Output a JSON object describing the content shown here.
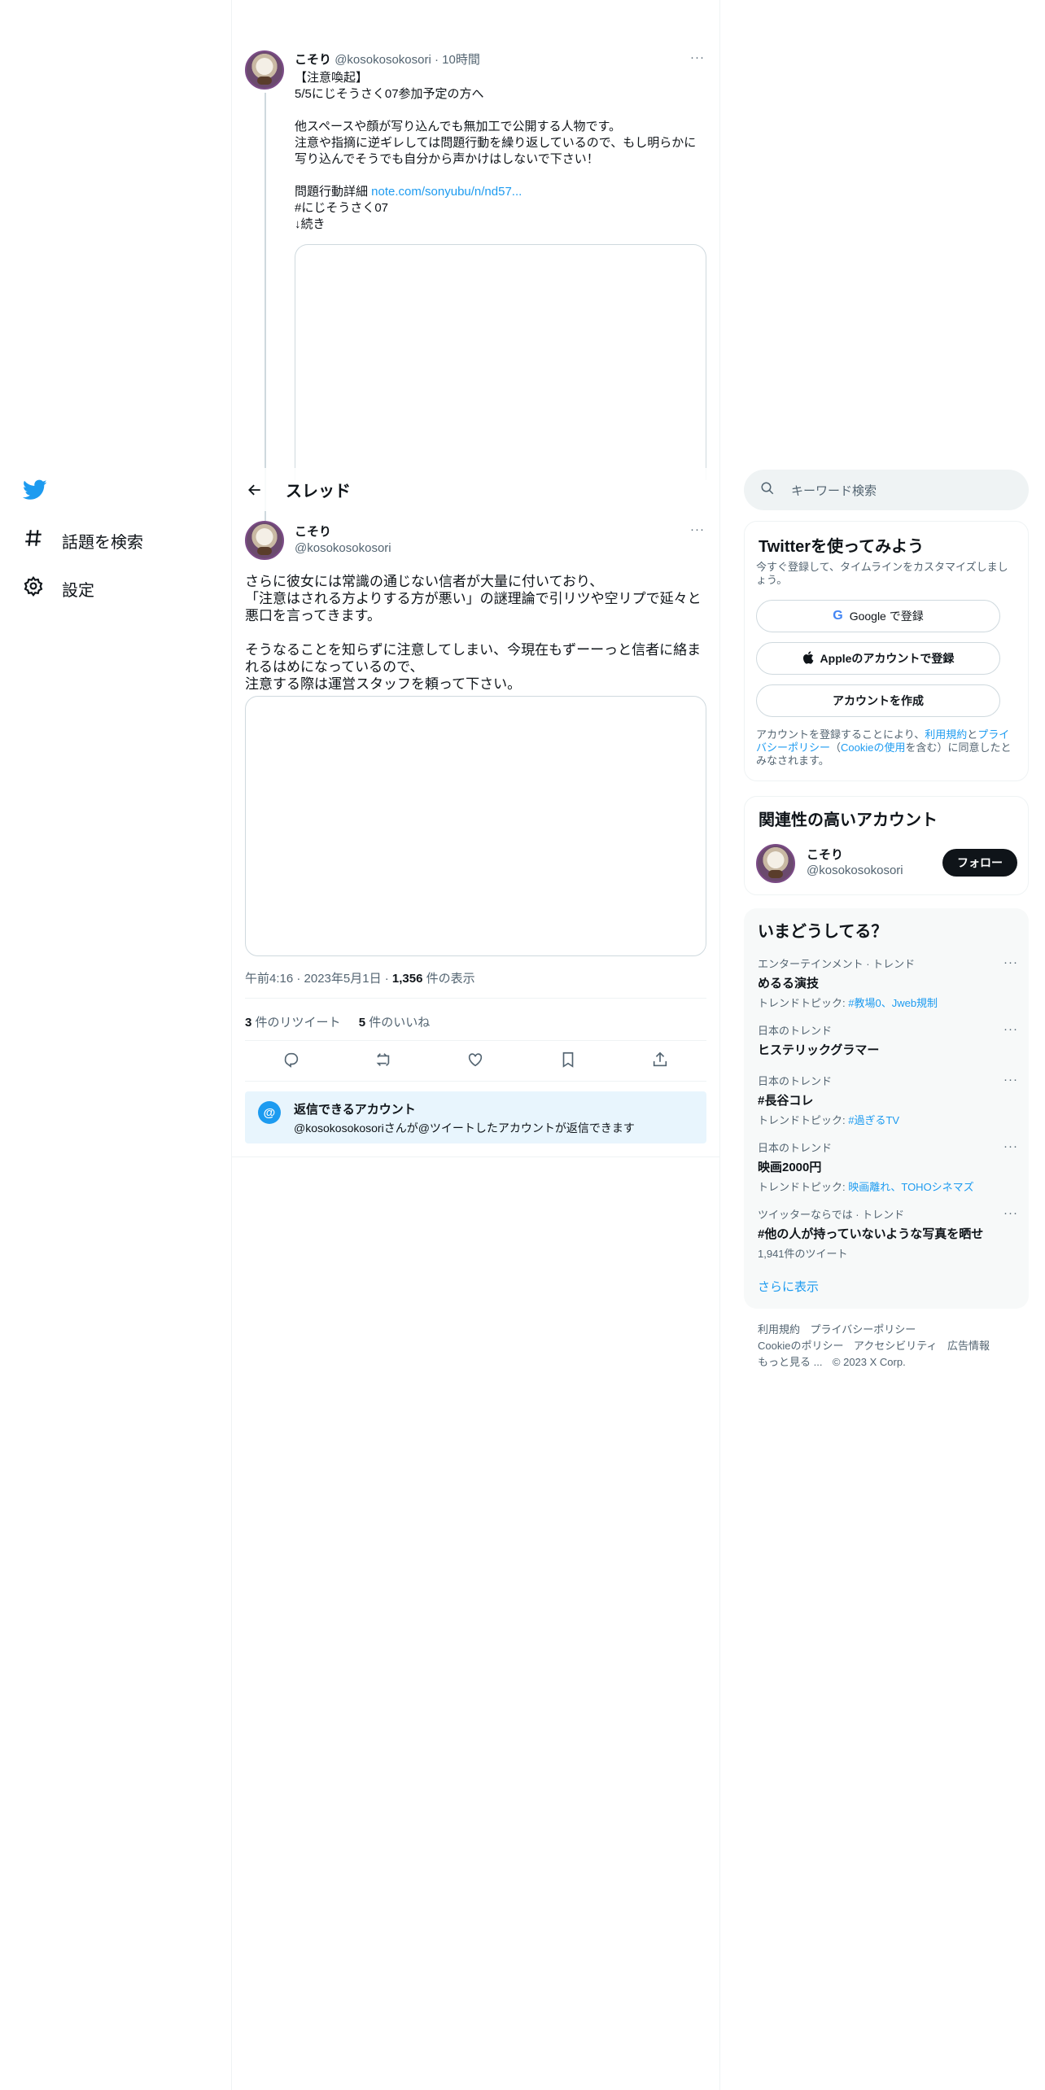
{
  "colors": {
    "accent": "#1d9bf0",
    "text": "#0f1419",
    "muted": "#536471",
    "follow_bg": "#0f1419"
  },
  "nav": {
    "logo_icon": "twitter-bird-icon",
    "items": [
      {
        "label": "話題を検索",
        "icon": "hashtag-icon"
      },
      {
        "label": "設定",
        "icon": "gear-icon"
      }
    ]
  },
  "header": {
    "title": "スレッド",
    "back_icon": "arrow-left-icon"
  },
  "parent_tweet": {
    "name": "こそり",
    "handle": "@kosokosokosori",
    "time": "· 10時間",
    "lines": [
      "【注意喚起】",
      "5/5にじそうさく07参加予定の方へ",
      "",
      "他スペースや顔が写り込んでも無加工で公開する人物です。",
      "注意や指摘に逆ギレしては問題行動を繰り返しているので、もし明らかに",
      "写り込んでそうでも自分から声かけはしないで下さい！",
      ""
    ],
    "detail_label": "問題行動詳細 ",
    "detail_link": "note.com/sonyubu/n/nd57...",
    "hashtag": "#にじそうさく07",
    "continued": "↓続き"
  },
  "main_tweet": {
    "name": "こそり",
    "handle": "@kosokosokosori",
    "paragraph1": [
      "さらに彼女には常識の通じない信者が大量に付いており、",
      "「注意はされる方よりする方が悪い」の謎理論で引リツや空リプで延々と",
      "悪口を言ってきます。"
    ],
    "paragraph2": [
      "そうなることを知らずに注意してしまい、今現在もずーーっと信者に絡ま",
      "れるはめになっているので、",
      "注意する際は運営スタッフを頼って下さい。"
    ],
    "timestamp": "午前4:16 · 2023年5月1日 · ",
    "views_count": "1,356",
    "views_label": " 件の表示",
    "retweets_count": "3",
    "retweets_label": " 件のリツイート",
    "likes_count": "5",
    "likes_label": " 件のいいね",
    "reply_restriction_title": "返信できるアカウント",
    "reply_restriction_text": "@kosokosokosoriさんが@ツイートしたアカウントが返信できます"
  },
  "search": {
    "placeholder": "キーワード検索"
  },
  "signup": {
    "title": "Twitterを使ってみよう",
    "subtitle": "今すぐ登録して、タイムラインをカスタマイズしましょう。",
    "google_label": "Google で登録",
    "apple_label": "Appleのアカウントで登録",
    "create_label": "アカウントを作成",
    "legal_pre": "アカウントを登録することにより、",
    "legal_terms": "利用規約",
    "legal_and": "と",
    "legal_privacy": "プライバシーポリシー",
    "legal_open": "（",
    "legal_cookie": "Cookieの使用",
    "legal_post": "を含む）に同意したとみなされます。"
  },
  "related": {
    "title": "関連性の高いアカウント",
    "name": "こそり",
    "handle": "@kosokosokosori",
    "follow_label": "フォロー"
  },
  "trends": {
    "title": "いまどうしてる？",
    "items": [
      {
        "category": "エンターテインメント · トレンド",
        "name": "めるる演技",
        "sub_label": "トレンドトピック: ",
        "sub_link": "#教場0、Jweb規制"
      },
      {
        "category": "日本のトレンド",
        "name": "ヒステリックグラマー",
        "sub_label": "",
        "sub_link": ""
      },
      {
        "category": "日本のトレンド",
        "name": "#長谷コレ",
        "sub_label": "トレンドトピック: ",
        "sub_link": "#過ぎるTV"
      },
      {
        "category": "日本のトレンド",
        "name": "映画2000円",
        "sub_label": "トレンドトピック: ",
        "sub_link": "映画離れ、TOHOシネマズ"
      },
      {
        "category": "ツイッターならでは · トレンド",
        "name": "#他の人が持っていないような写真を晒せ",
        "sub_label": "1,941件のツイート",
        "sub_link": ""
      }
    ],
    "show_more": "さらに表示"
  },
  "footer": {
    "row1": [
      "利用規約",
      "プライバシーポリシー"
    ],
    "row2": [
      "Cookieのポリシー",
      "アクセシビリティ",
      "広告情報"
    ],
    "more": "もっと見る ...",
    "copyright": "© 2023 X Corp."
  }
}
